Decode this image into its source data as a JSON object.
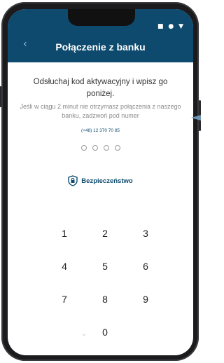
{
  "status_bar": {
    "icons": "■ ● ▼"
  },
  "header": {
    "back_icon": "‹",
    "title": "Połączenie z banku"
  },
  "main": {
    "instruction": "Odsłuchaj kod aktywacyjny i wpisz go poniżej.",
    "subtext": "Jeśli w ciągu 2 minut nie otrzymasz połączenia z naszego banku, zadzwoń pod numer",
    "phone_number": "(+48) 12 370 70 85",
    "code_length": 4,
    "security_label": "Bezpieczeństwo"
  },
  "keypad": {
    "keys": [
      "1",
      "2",
      "3",
      "4",
      "5",
      "6",
      "7",
      "8",
      "9",
      "",
      "0",
      ""
    ]
  },
  "colors": {
    "header_bg": "#0d4a6e",
    "accent": "#0d4a6e"
  }
}
